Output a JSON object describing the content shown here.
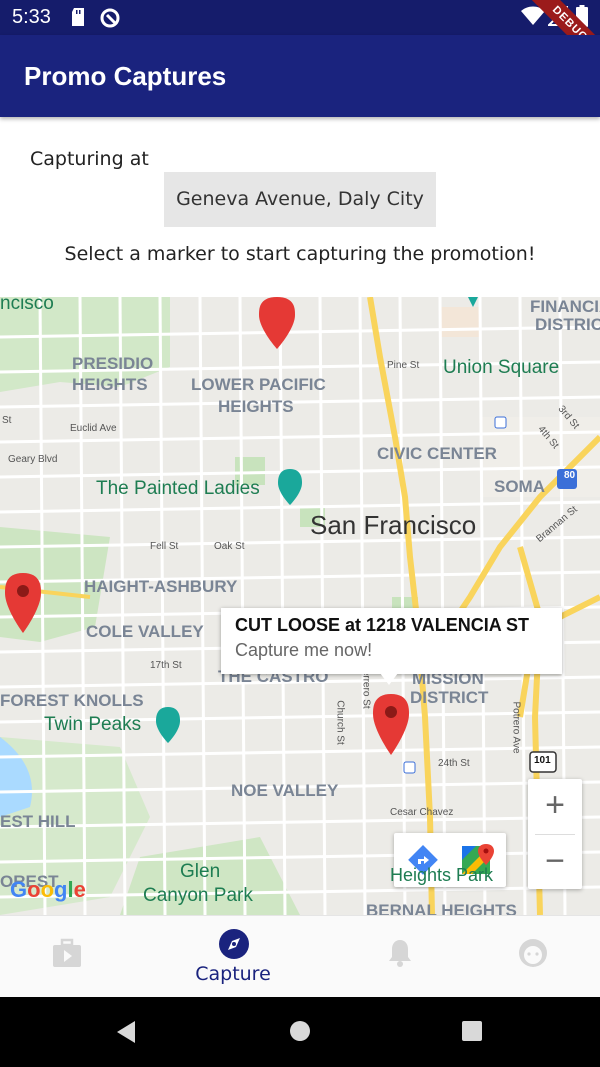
{
  "status_bar": {
    "time": "5:33",
    "icons": [
      "sd-card-icon",
      "sync-icon",
      "wifi-icon",
      "signal-icon",
      "battery-icon"
    ],
    "debug_banner": "DEBUG"
  },
  "app_bar": {
    "title": "Promo Captures"
  },
  "header": {
    "capturing_label": "Capturing at",
    "location": "Geneva Avenue, Daly City",
    "instruction": "Select a marker to start capturing the promotion!"
  },
  "map": {
    "labels": {
      "francisco": "ncisco",
      "financial": "FINANCIAL",
      "district": "DISTRICT",
      "presidio": "PRESIDIO",
      "heights": "HEIGHTS",
      "lower_pacific": "LOWER PACIFIC",
      "lower_heights": "HEIGHTS",
      "union_square": "Union Square",
      "pine_st": "Pine St",
      "euclid_ave": "Euclid Ave",
      "geary_blvd": "Geary Blvd",
      "st": "St",
      "civic_center": "CIVIC CENTER",
      "third_st": "3rd St",
      "fourth_st": "4th St",
      "painted_ladies": "The Painted Ladies",
      "soma": "SOMA",
      "san_francisco": "San Francisco",
      "fell_st": "Fell St",
      "oak_st": "Oak St",
      "brannan_st": "Brannan St",
      "haight_ashbury": "HAIGHT-ASHBURY",
      "cole_valley": "COLE VALLEY",
      "seventeenth_st": "17th St",
      "the_castro": "THE CASTRO",
      "mission": "MISSION",
      "mission_district": "DISTRICT",
      "forest_knolls": "FOREST KNOLLS",
      "twin_peaks": "Twin Peaks",
      "church_st": "Church St",
      "guerrero_st": "Guerrero St",
      "potrero_ave": "Potrero Ave",
      "twenty_fourth_st": "24th St",
      "noe_valley": "NOE VALLEY",
      "est_hill": "EST HILL",
      "cesar_chavez": "Cesar Chavez",
      "glen": "Glen",
      "canyon_park": "Canyon Park",
      "bernal_heights": "BERNAL HEIGHTS",
      "heights_park": "Heights Park",
      "orest": "OREST",
      "hwy_80": "80",
      "hwy_101": "101"
    },
    "info_window": {
      "title": "CUT LOOSE at 1218 VALENCIA ST",
      "subtitle": "Capture me now!"
    },
    "zoom_in": "+",
    "zoom_out": "−",
    "google_logo": "Google",
    "marker_color": "#e53935"
  },
  "bottom_nav": {
    "items": [
      {
        "icon": "briefcase-play-icon",
        "label": ""
      },
      {
        "icon": "compass-icon",
        "label": "Capture",
        "selected": true
      },
      {
        "icon": "bell-icon",
        "label": ""
      },
      {
        "icon": "face-icon",
        "label": ""
      }
    ],
    "accent": "#1a237e",
    "inactive": "#d6d6d6"
  },
  "system_nav": {
    "icons": [
      "back-icon",
      "home-icon",
      "recents-icon"
    ]
  }
}
